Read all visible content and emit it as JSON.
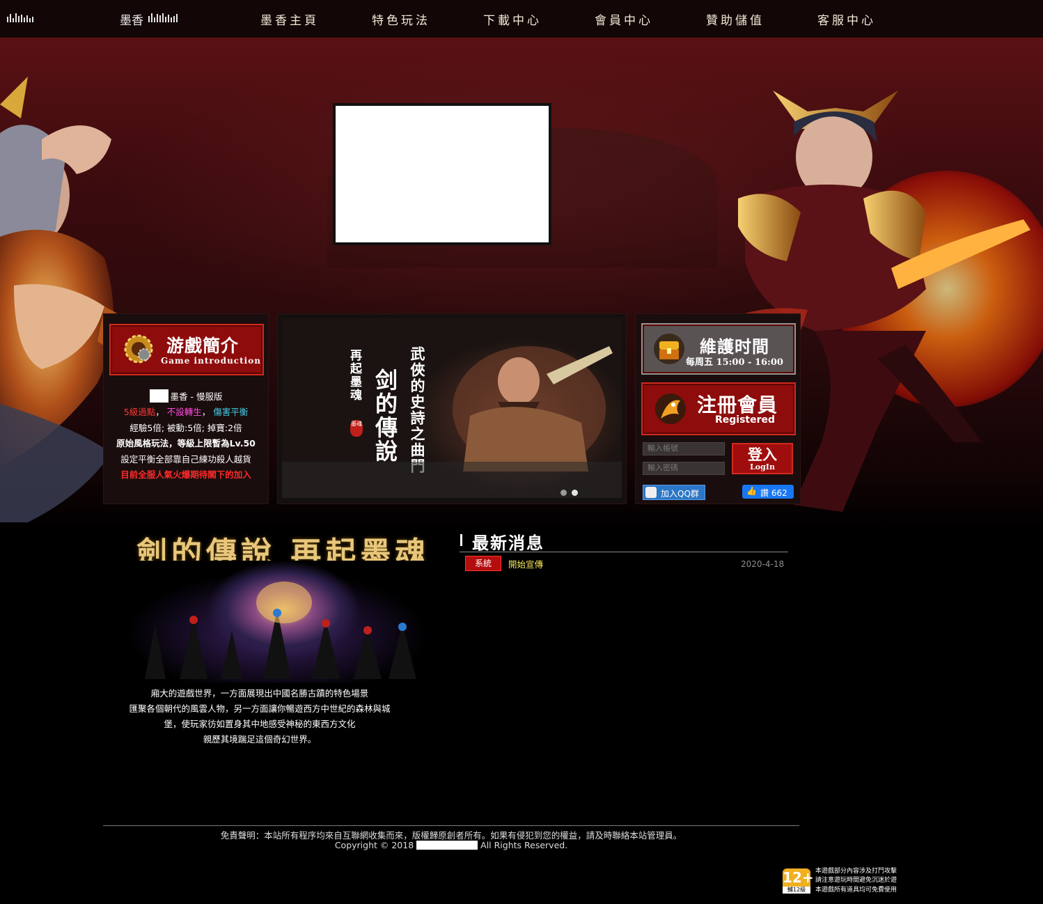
{
  "nav": {
    "brand": "墨香",
    "items": [
      "墨香主頁",
      "特色玩法",
      "下載中心",
      "會員中心",
      "贊助儲值",
      "客服中心"
    ]
  },
  "intro": {
    "title": "游戲簡介",
    "subtitle": "Game introduction",
    "version": "墨香 - 慢服版",
    "line1": [
      "5級過點",
      "不設轉生",
      "傷害平衡"
    ],
    "line2": "經驗5倍; 被動:5倍; 掉寶:2倍",
    "line3": "原始風格玩法，等級上限暫為Lv.50",
    "line4": "設定平衡全部靠自己練功殺人越貨",
    "line5": "目前全服人氣火爆期待閣下的加入"
  },
  "slider": {
    "col1": "再起墨魂",
    "col2": "剑的傳說",
    "col3": "武俠的史詩之曲門",
    "seal": "墨魂",
    "active_dot": 2
  },
  "maintenance": {
    "title": "維護时間",
    "subtitle": "每周五 15:00 - 16:00"
  },
  "register": {
    "title": "注冊會員",
    "subtitle": "Registered"
  },
  "login": {
    "account_placeholder": "輸入帳號",
    "password_placeholder": "輸入密碼",
    "button": "登入",
    "button_sub": "LogIn",
    "qq": "加入QQ群",
    "like": "讚 662"
  },
  "showcase": {
    "title": "劍的傳說 再起墨魂",
    "description": [
      "廂大的遊戲世界，一方面展現出中國名勝古蹟的特色場景",
      "匯聚各個朝代的風雲人物，另一方面讓你暢遊西方中世紀的森林與城",
      "堡，使玩家彷如置身其中地感受神秘的東西方文化",
      "親歷其境踹足這個奇幻世界。"
    ]
  },
  "news": {
    "heading": "最新消息",
    "items": [
      {
        "tag": "系統",
        "title": "開始宣傳",
        "date": "2020-4-18"
      }
    ]
  },
  "footer": {
    "disclaimer": "免責聲明：本站所有程序均來自互聯網收集而來，版權歸原創者所有。如果有侵犯到您的權益，請及時聯絡本站管理員。",
    "copyright_prefix": "Copyright © 2018",
    "copyright_suffix": "All Rights Reserved.",
    "rating_badge": "12+",
    "rating_label": "輔12級",
    "rating_notes": [
      "本遊戲部分內容涉及打鬥攻擊",
      "請注意遊玩時間避免沉迷於遊",
      "本遊戲所有道具均可免費使用"
    ]
  },
  "colors": {
    "accent_red": "#a00d0d",
    "gold": "#e8c77b",
    "news_title": "#f4e65a",
    "fb_blue": "#1877f2"
  }
}
